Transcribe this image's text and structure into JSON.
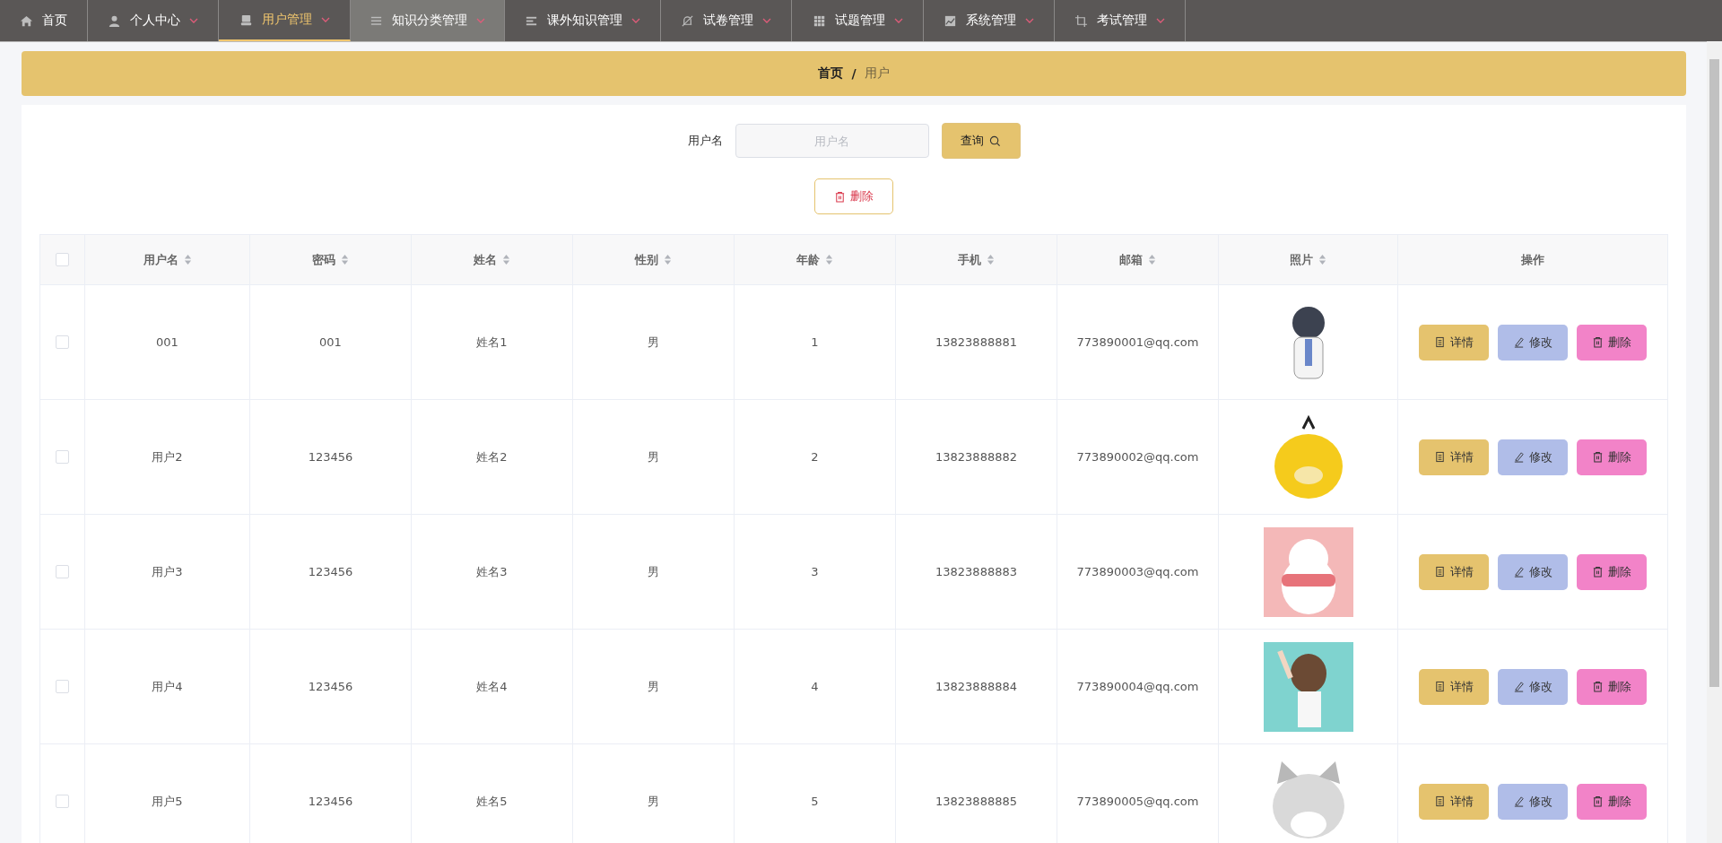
{
  "nav": [
    {
      "label": "首页",
      "kind": "home",
      "dropdown": false,
      "selected": false,
      "hovered": false
    },
    {
      "label": "个人中心",
      "kind": "user",
      "dropdown": true,
      "selected": false,
      "hovered": false
    },
    {
      "label": "用户管理",
      "kind": "box",
      "dropdown": true,
      "selected": true,
      "hovered": false
    },
    {
      "label": "知识分类管理",
      "kind": "list",
      "dropdown": true,
      "selected": false,
      "hovered": true
    },
    {
      "label": "课外知识管理",
      "kind": "lines",
      "dropdown": true,
      "selected": false,
      "hovered": false
    },
    {
      "label": "试卷管理",
      "kind": "bell",
      "dropdown": true,
      "selected": false,
      "hovered": false
    },
    {
      "label": "试题管理",
      "kind": "grid",
      "dropdown": true,
      "selected": false,
      "hovered": false
    },
    {
      "label": "系统管理",
      "kind": "chart",
      "dropdown": true,
      "selected": false,
      "hovered": false
    },
    {
      "label": "考试管理",
      "kind": "crop",
      "dropdown": true,
      "selected": false,
      "hovered": false
    }
  ],
  "breadcrumb": {
    "items": [
      "首页",
      "用户"
    ],
    "separator": "/"
  },
  "search": {
    "label": "用户名",
    "placeholder": "用户名",
    "button": "查询"
  },
  "delete_button": "删除",
  "table": {
    "columns": [
      {
        "label": "用户名",
        "sortable": true
      },
      {
        "label": "密码",
        "sortable": true
      },
      {
        "label": "姓名",
        "sortable": true
      },
      {
        "label": "性别",
        "sortable": true
      },
      {
        "label": "年龄",
        "sortable": true
      },
      {
        "label": "手机",
        "sortable": true
      },
      {
        "label": "邮箱",
        "sortable": true
      },
      {
        "label": "照片",
        "sortable": true
      },
      {
        "label": "操作",
        "sortable": false
      }
    ],
    "header_checked": false,
    "rows": [
      {
        "checked": false,
        "cells": [
          "001",
          "001",
          "姓名1",
          "男",
          "1",
          "13823888881",
          "773890001@qq.com"
        ],
        "actions": [
          "详情",
          "修改",
          "删除"
        ]
      },
      {
        "checked": false,
        "cells": [
          "用户2",
          "123456",
          "姓名2",
          "男",
          "2",
          "13823888882",
          "773890002@qq.com"
        ],
        "actions": [
          "详情",
          "修改",
          "删除"
        ]
      },
      {
        "checked": false,
        "cells": [
          "用户3",
          "123456",
          "姓名3",
          "男",
          "3",
          "13823888883",
          "773890003@qq.com"
        ],
        "actions": [
          "详情",
          "修改",
          "删除"
        ]
      },
      {
        "checked": false,
        "cells": [
          "用户4",
          "123456",
          "姓名4",
          "男",
          "4",
          "13823888884",
          "773890004@qq.com"
        ],
        "actions": [
          "详情",
          "修改",
          "删除"
        ]
      },
      {
        "checked": false,
        "cells": [
          "用户5",
          "123456",
          "姓名5",
          "男",
          "5",
          "13823888885",
          "773890005@qq.com"
        ],
        "actions": [
          "详情",
          "修改",
          "删除"
        ]
      }
    ]
  }
}
